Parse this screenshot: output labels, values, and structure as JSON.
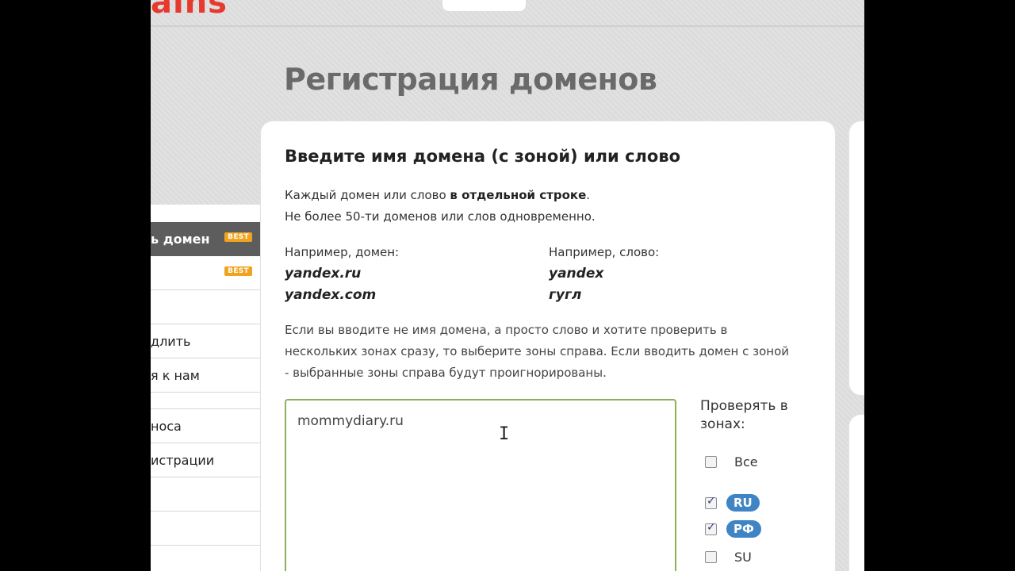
{
  "header": {
    "logo_fragment": "ains",
    "page_title": "Регистрация доменов"
  },
  "sidebar": {
    "items": [
      {
        "label": "ь домен",
        "badge": "BEST",
        "active": true
      },
      {
        "label": "",
        "badge": "BEST"
      },
      {
        "label": ""
      },
      {
        "label": "длить"
      },
      {
        "label": "я к нам"
      },
      {
        "label": "носа"
      },
      {
        "label": "истрации"
      },
      {
        "label": ""
      },
      {
        "label": ""
      }
    ]
  },
  "form": {
    "title": "Введите имя домена (с зоной) или слово",
    "intro_line1_prefix": "Каждый домен или слово ",
    "intro_line1_bold": "в отдельной строке",
    "intro_line1_suffix": ".",
    "intro_line2": "Не более 50-ти доменов или слов одновременно.",
    "example_domain_label": "Например, домен:",
    "example_domains": [
      "yandex.ru",
      "yandex.com"
    ],
    "example_word_label": "Например, слово:",
    "example_words": [
      "yandex",
      "гугл"
    ],
    "hint": "Если вы вводите не имя домена, а просто слово и хотите проверить в нескольких зонах сразу, то выберите зоны справа. Если вводить домен с зоной - выбранные зоны справа будут проигнорированы.",
    "domain_input_value": "mommydiary.ru",
    "zones_label_line1": "Проверять в",
    "zones_label_line2": "зонах:",
    "zones": [
      {
        "name": "Все",
        "checked": false,
        "style": "plain"
      },
      {
        "name": "RU",
        "checked": true,
        "style": "pill"
      },
      {
        "name": "РФ",
        "checked": true,
        "style": "pill"
      },
      {
        "name": "SU",
        "checked": false,
        "style": "plain"
      }
    ]
  },
  "colors": {
    "accent_red": "#e63a2e",
    "badge_orange": "#f0a31d",
    "zone_pill_blue": "#3f84c4",
    "input_border_green": "#8bb05a"
  }
}
